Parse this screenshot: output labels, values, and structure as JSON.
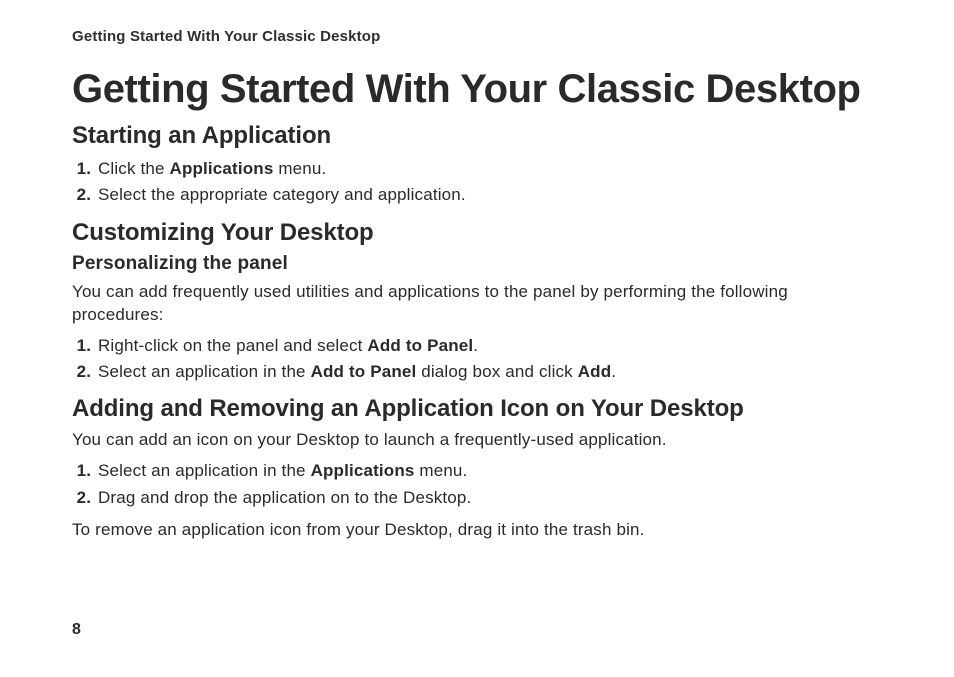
{
  "runningHeader": "Getting Started With Your Classic Desktop",
  "title": "Getting Started With Your Classic Desktop",
  "pageNumber": "8",
  "section1": {
    "heading": "Starting an Application",
    "step1": {
      "pre": "Click the ",
      "bold": "Applications",
      "post": " menu."
    },
    "step2": "Select the appropriate category and application."
  },
  "section2": {
    "heading": "Customizing Your Desktop",
    "sub1": {
      "heading": "Personalizing the panel",
      "intro": "You can add frequently used utilities and applications to the panel by performing the following procedures:",
      "step1": {
        "pre": "Right-click on the panel and select ",
        "bold": "Add to Panel",
        "post": "."
      },
      "step2": {
        "pre": "Select an application in the ",
        "bold1": "Add to Panel",
        "mid": " dialog box and click ",
        "bold2": "Add",
        "post": "."
      }
    }
  },
  "section3": {
    "heading": "Adding and Removing an Application Icon on Your Desktop",
    "intro": "You can add an icon on your Desktop to launch a frequently-used application.",
    "step1": {
      "pre": "Select an application in the ",
      "bold": "Applications",
      "post": " menu."
    },
    "step2": "Drag and drop the application on to the Desktop.",
    "outro": "To remove an application icon from your Desktop, drag it into the trash bin."
  }
}
